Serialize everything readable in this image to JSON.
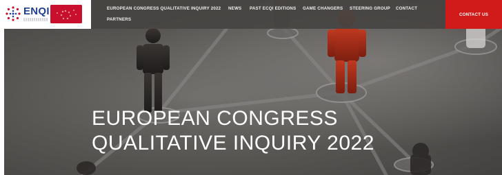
{
  "logo": {
    "wordmark": "ENQI",
    "icon": "dot-cluster-icon",
    "flag_icon": "flag-icon"
  },
  "nav": {
    "items": [
      {
        "label": "EUROPEAN CONGRESS QUALITATIVE INQUIRY 2022"
      },
      {
        "label": "NEWS"
      },
      {
        "label": "PAST ECQI EDITIONS"
      },
      {
        "label": "GAME CHANGERS"
      },
      {
        "label": "STEERING GROUP"
      },
      {
        "label": "CONTACT"
      },
      {
        "label": "PARTNERS"
      }
    ],
    "cta_label": "CONTACT US"
  },
  "hero": {
    "title_line1": "EUROPEAN CONGRESS",
    "title_line2": "QUALITATIVE INQUIRY 2022"
  },
  "colors": {
    "brand_blue": "#1f3f8f",
    "accent_red": "#d11a1a",
    "nav_bg": "#464442"
  }
}
